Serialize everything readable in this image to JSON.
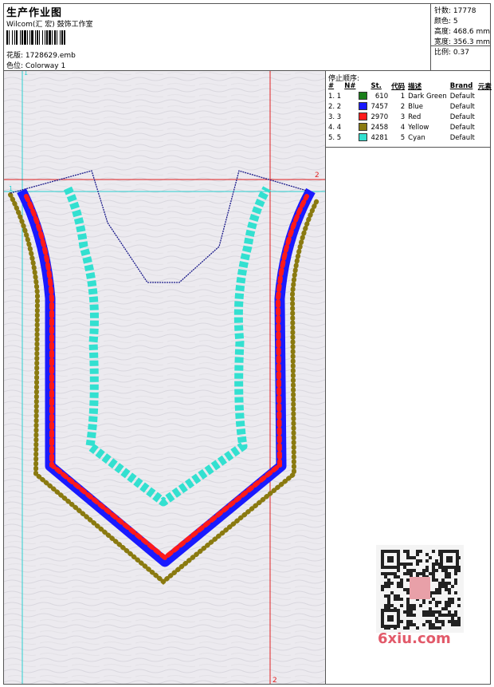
{
  "header": {
    "title": "生产作业图",
    "subtitle": "Wilcom(汇 宏) 鼓饰工作室",
    "design_label": "花版:",
    "design_file": "1728629.emb",
    "colorway_label": "色位:",
    "colorway": "Colorway 1"
  },
  "stats": {
    "stitches": "针数: 17778",
    "colors": "颜色: 5",
    "height": "高度: 468.6 mm",
    "width": "宽度: 356.3 mm",
    "scale": "比例: 0.37"
  },
  "stop_sequence": {
    "title": "停止顺序:",
    "columns": [
      "#",
      "N#",
      "St.",
      "代码",
      "描述",
      "Brand",
      "元素"
    ],
    "rows": [
      {
        "idx": "1. 1",
        "color": "#1a7f1a",
        "st": "610",
        "code": "1",
        "desc": "Dark Green",
        "brand": "Default"
      },
      {
        "idx": "2. 2",
        "color": "#1a1aff",
        "st": "7457",
        "code": "2",
        "desc": "Blue",
        "brand": "Default"
      },
      {
        "idx": "3. 3",
        "color": "#ff1a1a",
        "st": "2970",
        "code": "3",
        "desc": "Red",
        "brand": "Default"
      },
      {
        "idx": "4. 4",
        "color": "#8a7a10",
        "st": "2458",
        "code": "4",
        "desc": "Yellow",
        "brand": "Default"
      },
      {
        "idx": "5. 5",
        "color": "#33e0d0",
        "st": "4281",
        "code": "5",
        "desc": "Cyan",
        "brand": "Default"
      }
    ]
  },
  "guides": {
    "marker_1": "1",
    "marker_2": "2"
  },
  "colors": {
    "blue": "#1a1aff",
    "red": "#ff1a1a",
    "cyan": "#33e0d0",
    "olive": "#8a7a10",
    "navy": "#1a1a8a",
    "guide_cyan": "#2ad0d0",
    "guide_red": "#e02020"
  },
  "watermark": {
    "brand": "6xiu.com",
    "qr_label": "qr-code"
  }
}
